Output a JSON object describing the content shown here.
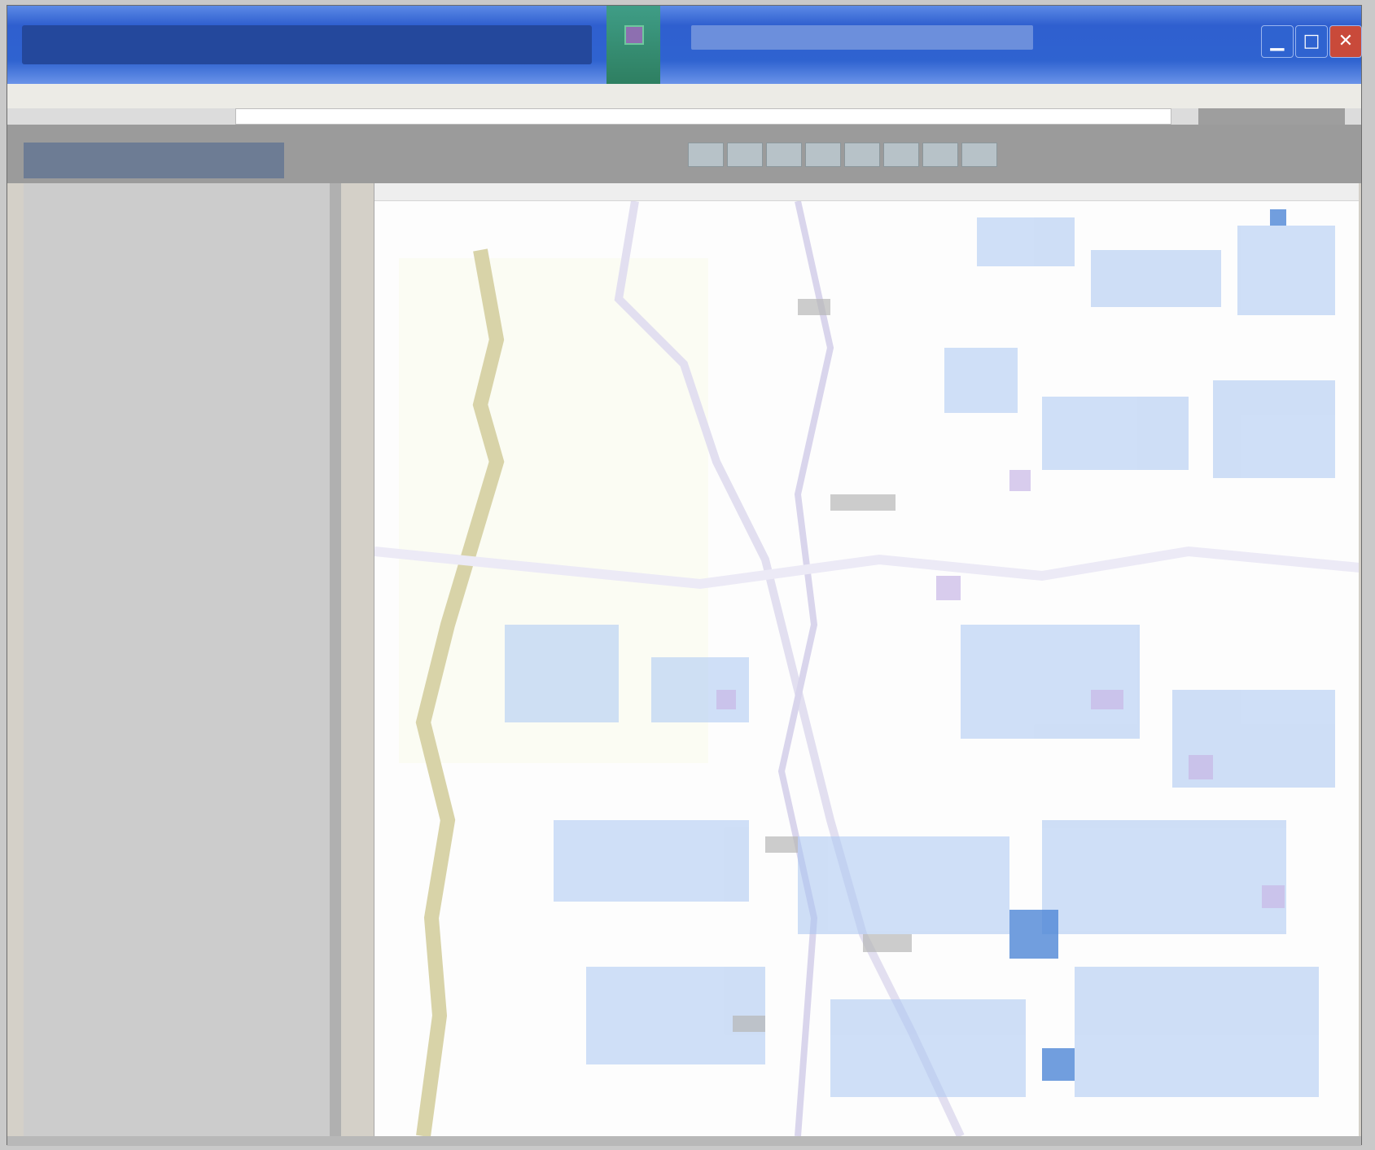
{
  "window": {
    "title": "",
    "subtitle": ""
  },
  "menubar": {
    "items": []
  },
  "address": {
    "value": "",
    "go_label": ""
  },
  "toolbar": {
    "panel_label": ""
  },
  "sidebar": {
    "items": []
  },
  "status": {
    "text": ""
  },
  "colors": {
    "titlebar": "#2f63d0",
    "panel": "#cccccc",
    "content": "#fdfdfd",
    "map_accent_blue": "#a9c6f2",
    "map_accent_purple": "#c8b7e6",
    "map_accent_olive": "#d8d3a8"
  },
  "icons": {
    "window_minimize": "minimize-icon",
    "window_maximize": "maximize-icon",
    "window_close": "close-icon"
  }
}
